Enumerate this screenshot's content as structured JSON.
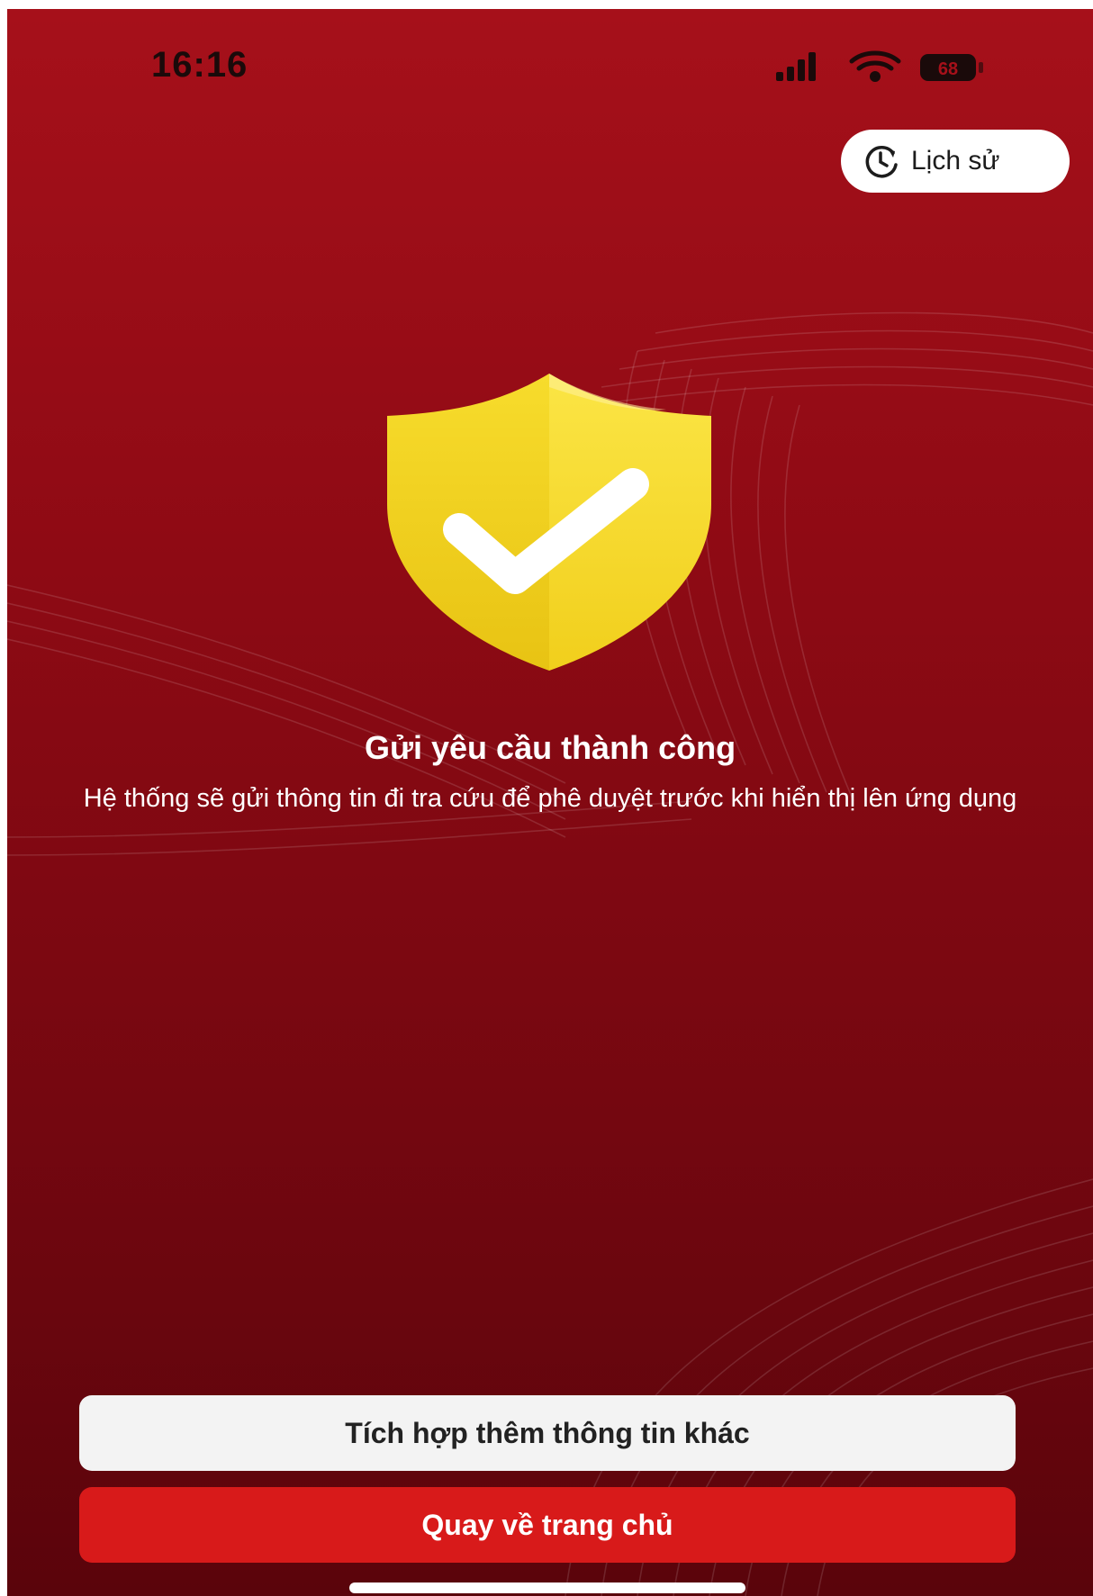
{
  "status_bar": {
    "time": "16:16",
    "battery": "68",
    "icons": [
      "signal-icon",
      "wifi-icon",
      "battery-icon"
    ]
  },
  "header": {
    "history_label": "Lịch sử",
    "history_icon": "clock-history-icon"
  },
  "result": {
    "icon": "shield-check-icon",
    "title": "Gửi yêu cầu thành công",
    "description": "Hệ thống sẽ gửi thông tin đi tra cứu để phê duyệt trước khi hiển thị lên ứng dụng"
  },
  "actions": {
    "secondary_label": "Tích hợp thêm thông tin khác",
    "primary_label": "Quay về trang chủ"
  },
  "colors": {
    "background": "#8e0a14",
    "primary_button": "#d81a1a",
    "secondary_button": "#f3f3f3",
    "shield": "#f5d21e"
  }
}
